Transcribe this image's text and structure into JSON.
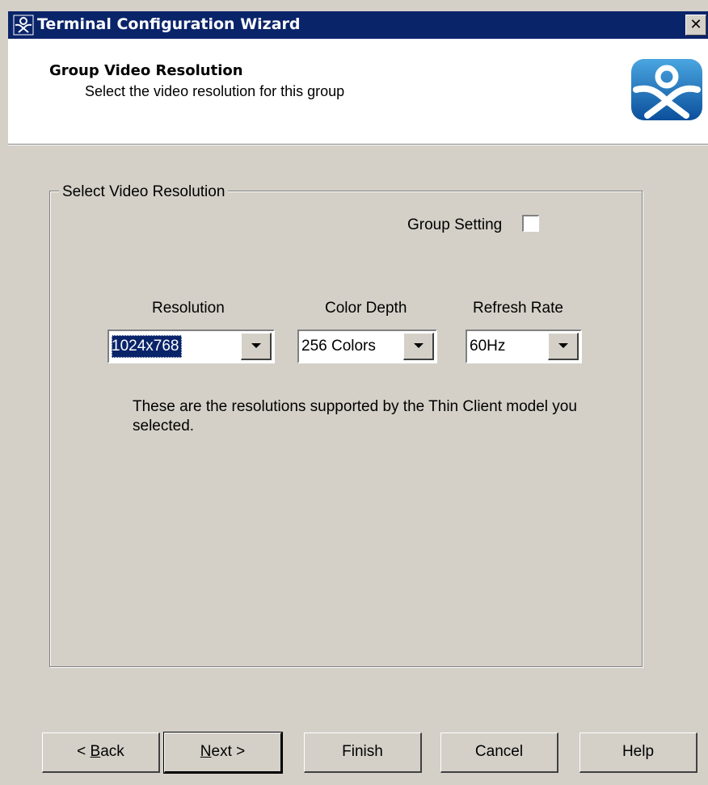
{
  "window": {
    "title": "Terminal Configuration Wizard",
    "close_glyph": "✕"
  },
  "header": {
    "title": "Group Video Resolution",
    "subtitle": "Select the video resolution for this group",
    "logo_icon": "terminal-logo-icon"
  },
  "group": {
    "legend": "Select Video Resolution",
    "group_setting_label": "Group Setting",
    "group_setting_checked": false
  },
  "resolution": {
    "label": "Resolution",
    "value": "1024x768"
  },
  "color_depth": {
    "label": "Color Depth",
    "value": "256 Colors"
  },
  "refresh_rate": {
    "label": "Refresh Rate",
    "value": "60Hz"
  },
  "note": "These are the resolutions supported by the Thin Client model you selected.",
  "buttons": {
    "back_prefix": "< ",
    "back_key": "B",
    "back_rest": "ack",
    "next_key": "N",
    "next_rest": "ext >",
    "finish": "Finish",
    "cancel": "Cancel",
    "help": "Help"
  },
  "colors": {
    "titlebar": "#0a246a",
    "face": "#d4d0c8",
    "selection": "#0a246a"
  }
}
